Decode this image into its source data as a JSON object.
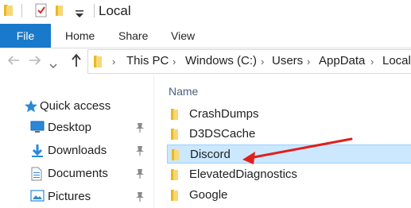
{
  "window": {
    "title": "Local"
  },
  "ribbon": {
    "tabs": [
      {
        "label": "File",
        "active": true
      },
      {
        "label": "Home"
      },
      {
        "label": "Share"
      },
      {
        "label": "View"
      }
    ]
  },
  "address": {
    "crumbs": [
      "This PC",
      "Windows (C:)",
      "Users",
      "AppData",
      "Local"
    ]
  },
  "navpane": {
    "items": [
      {
        "label": "Quick access",
        "icon": "star-icon"
      },
      {
        "label": "Desktop",
        "icon": "desktop-icon",
        "pinned": true
      },
      {
        "label": "Downloads",
        "icon": "downloads-icon",
        "pinned": true
      },
      {
        "label": "Documents",
        "icon": "documents-icon",
        "pinned": true
      },
      {
        "label": "Pictures",
        "icon": "pictures-icon",
        "pinned": true
      }
    ]
  },
  "content": {
    "column_header": "Name",
    "rows": [
      {
        "name": "CrashDumps",
        "selected": false
      },
      {
        "name": "D3DSCache",
        "selected": false
      },
      {
        "name": "Discord",
        "selected": true
      },
      {
        "name": "ElevatedDiagnostics",
        "selected": false
      },
      {
        "name": "Google",
        "selected": false
      }
    ]
  },
  "colors": {
    "accent": "#1979ca",
    "selection_bg": "#cce8ff",
    "selection_border": "#99d1ff",
    "folder": "#f8d775",
    "annotation": "#e0201b"
  }
}
